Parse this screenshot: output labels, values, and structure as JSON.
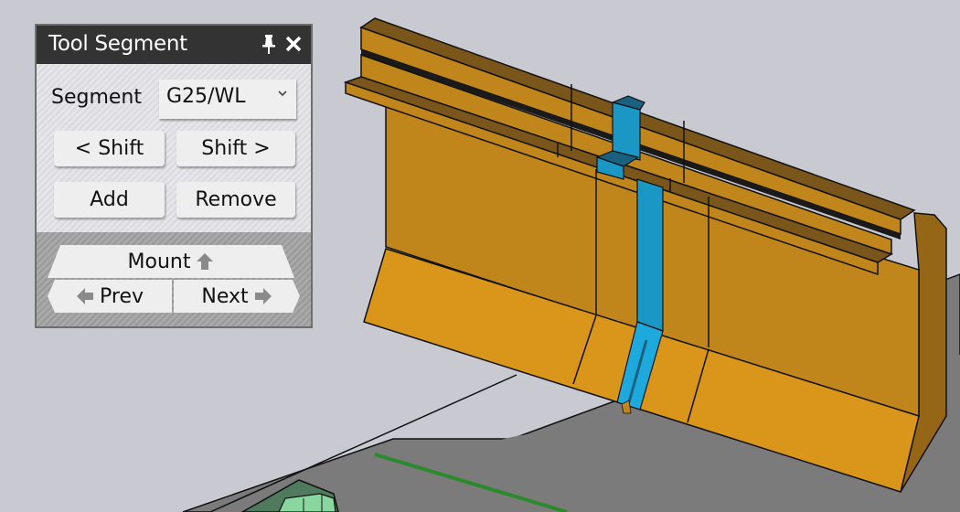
{
  "panel": {
    "title": "Tool Segment",
    "icons": {
      "pin": "pin-icon",
      "close": "close-icon"
    },
    "segment_label": "Segment",
    "segment_value": "G25/WL",
    "segment_dropdown_icon": "chevron-down-icon",
    "buttons": {
      "shift_left": "< Shift",
      "shift_right": "Shift >",
      "add": "Add",
      "remove": "Remove"
    },
    "navigation": {
      "mount": "Mount",
      "mount_icon": "arrow-up-icon",
      "prev": "Prev",
      "prev_icon": "arrow-left-icon",
      "next": "Next",
      "next_icon": "arrow-right-icon"
    }
  },
  "viewport": {
    "description": "3D view of press brake tool segments; selected segment highlighted",
    "colors": {
      "background": "#c9c9d1",
      "tool_face": "#c0861c",
      "tool_top": "#7a561b",
      "tool_front_light": "#d9961a",
      "tool_side": "#956615",
      "selected_segment": "#1a97c4",
      "selected_segment_top": "#1a6180",
      "table": "#7b7b7b",
      "guide_line": "#2c8a2c",
      "fixture": "#8ad6a0",
      "fixture_dark": "#4f7a5e",
      "edge": "#111111"
    }
  }
}
